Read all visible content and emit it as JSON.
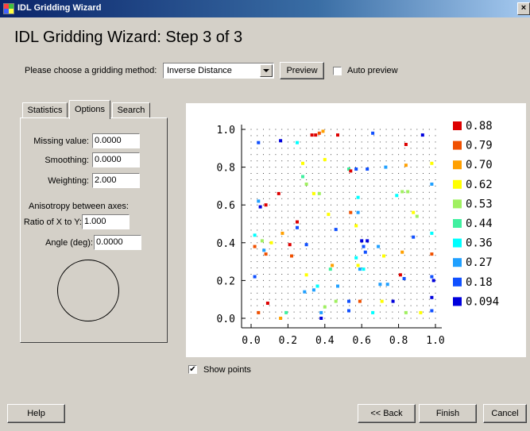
{
  "window": {
    "title": "IDL Gridding Wizard",
    "close_symbol": "×"
  },
  "wizard": {
    "step_title": "IDL Gridding Wizard: Step 3 of 3"
  },
  "method": {
    "prompt": "Please choose a gridding method:",
    "selected": "Inverse Distance",
    "preview_label": "Preview",
    "auto_preview_label": "Auto preview",
    "auto_preview_checked": false
  },
  "tabs": [
    {
      "label": "Statistics",
      "active": false
    },
    {
      "label": "Options",
      "active": true
    },
    {
      "label": "Search",
      "active": false
    }
  ],
  "options": {
    "missing_value_label": "Missing value:",
    "missing_value": "0.0000",
    "smoothing_label": "Smoothing:",
    "smoothing": "0.0000",
    "weighting_label": "Weighting:",
    "weighting": "2.000",
    "anisotropy_label": "Anisotropy between axes:",
    "ratio_label": "Ratio of X to Y:",
    "ratio": "1.000",
    "angle_label": "Angle (deg):",
    "angle": "0.0000"
  },
  "show_points": {
    "label": "Show points",
    "checked": true
  },
  "footer": {
    "help_label": "Help",
    "back_label": "<< Back",
    "finish_label": "Finish",
    "cancel_label": "Cancel"
  },
  "chart_data": {
    "type": "scatter",
    "xlim": [
      0,
      1
    ],
    "ylim": [
      0,
      1
    ],
    "x_ticks": [
      "0.0",
      "0.2",
      "0.4",
      "0.6",
      "0.8",
      "1.0"
    ],
    "y_ticks": [
      "0.0",
      "0.2",
      "0.4",
      "0.6",
      "0.8",
      "1.0"
    ],
    "grid_dots": true,
    "legend": [
      {
        "label": "0.88",
        "color": "#dd0000"
      },
      {
        "label": "0.79",
        "color": "#f05000"
      },
      {
        "label": "0.70",
        "color": "#ffa000"
      },
      {
        "label": "0.62",
        "color": "#ffff00"
      },
      {
        "label": "0.53",
        "color": "#a0f060"
      },
      {
        "label": "0.44",
        "color": "#40f0a0"
      },
      {
        "label": "0.36",
        "color": "#00ffff"
      },
      {
        "label": "0.27",
        "color": "#20a0ff"
      },
      {
        "label": "0.18",
        "color": "#1050ff"
      },
      {
        "label": "0.094",
        "color": "#0000dd"
      }
    ],
    "points": [
      {
        "x": 0.04,
        "y": 0.93,
        "c": 8
      },
      {
        "x": 0.16,
        "y": 0.94,
        "c": 9
      },
      {
        "x": 0.25,
        "y": 0.93,
        "c": 6
      },
      {
        "x": 0.33,
        "y": 0.97,
        "c": 0
      },
      {
        "x": 0.35,
        "y": 0.97,
        "c": 0
      },
      {
        "x": 0.37,
        "y": 0.98,
        "c": 1
      },
      {
        "x": 0.39,
        "y": 0.99,
        "c": 2
      },
      {
        "x": 0.47,
        "y": 0.97,
        "c": 0
      },
      {
        "x": 0.66,
        "y": 0.98,
        "c": 8
      },
      {
        "x": 0.84,
        "y": 0.92,
        "c": 0
      },
      {
        "x": 0.93,
        "y": 0.97,
        "c": 9
      },
      {
        "x": 0.98,
        "y": 0.82,
        "c": 3
      },
      {
        "x": 0.28,
        "y": 0.82,
        "c": 3
      },
      {
        "x": 0.4,
        "y": 0.84,
        "c": 3
      },
      {
        "x": 0.53,
        "y": 0.79,
        "c": 5
      },
      {
        "x": 0.54,
        "y": 0.78,
        "c": 0
      },
      {
        "x": 0.57,
        "y": 0.79,
        "c": 8
      },
      {
        "x": 0.63,
        "y": 0.79,
        "c": 8
      },
      {
        "x": 0.73,
        "y": 0.8,
        "c": 7
      },
      {
        "x": 0.84,
        "y": 0.81,
        "c": 2
      },
      {
        "x": 0.28,
        "y": 0.75,
        "c": 5
      },
      {
        "x": 0.3,
        "y": 0.71,
        "c": 4
      },
      {
        "x": 0.82,
        "y": 0.67,
        "c": 4
      },
      {
        "x": 0.85,
        "y": 0.67,
        "c": 4
      },
      {
        "x": 0.98,
        "y": 0.71,
        "c": 7
      },
      {
        "x": 0.04,
        "y": 0.62,
        "c": 7
      },
      {
        "x": 0.08,
        "y": 0.6,
        "c": 0
      },
      {
        "x": 0.05,
        "y": 0.59,
        "c": 9
      },
      {
        "x": 0.15,
        "y": 0.66,
        "c": 0
      },
      {
        "x": 0.34,
        "y": 0.66,
        "c": 3
      },
      {
        "x": 0.37,
        "y": 0.66,
        "c": 4
      },
      {
        "x": 0.58,
        "y": 0.64,
        "c": 6
      },
      {
        "x": 0.79,
        "y": 0.65,
        "c": 6
      },
      {
        "x": 0.88,
        "y": 0.56,
        "c": 3
      },
      {
        "x": 0.9,
        "y": 0.54,
        "c": 4
      },
      {
        "x": 0.25,
        "y": 0.51,
        "c": 0
      },
      {
        "x": 0.42,
        "y": 0.55,
        "c": 3
      },
      {
        "x": 0.54,
        "y": 0.56,
        "c": 1
      },
      {
        "x": 0.58,
        "y": 0.56,
        "c": 7
      },
      {
        "x": 0.25,
        "y": 0.48,
        "c": 8
      },
      {
        "x": 0.57,
        "y": 0.49,
        "c": 3
      },
      {
        "x": 0.46,
        "y": 0.47,
        "c": 8
      },
      {
        "x": 0.17,
        "y": 0.45,
        "c": 2
      },
      {
        "x": 0.02,
        "y": 0.44,
        "c": 6
      },
      {
        "x": 0.06,
        "y": 0.41,
        "c": 4
      },
      {
        "x": 0.11,
        "y": 0.4,
        "c": 3
      },
      {
        "x": 0.02,
        "y": 0.38,
        "c": 1
      },
      {
        "x": 0.07,
        "y": 0.36,
        "c": 7
      },
      {
        "x": 0.08,
        "y": 0.34,
        "c": 1
      },
      {
        "x": 0.21,
        "y": 0.39,
        "c": 0
      },
      {
        "x": 0.3,
        "y": 0.39,
        "c": 8
      },
      {
        "x": 0.6,
        "y": 0.41,
        "c": 9
      },
      {
        "x": 0.63,
        "y": 0.41,
        "c": 9
      },
      {
        "x": 0.61,
        "y": 0.38,
        "c": 8
      },
      {
        "x": 0.69,
        "y": 0.38,
        "c": 7
      },
      {
        "x": 0.62,
        "y": 0.35,
        "c": 8
      },
      {
        "x": 0.82,
        "y": 0.35,
        "c": 2
      },
      {
        "x": 0.88,
        "y": 0.43,
        "c": 8
      },
      {
        "x": 0.98,
        "y": 0.45,
        "c": 6
      },
      {
        "x": 0.22,
        "y": 0.33,
        "c": 1
      },
      {
        "x": 0.57,
        "y": 0.32,
        "c": 6
      },
      {
        "x": 0.72,
        "y": 0.33,
        "c": 3
      },
      {
        "x": 0.98,
        "y": 0.34,
        "c": 1
      },
      {
        "x": 0.44,
        "y": 0.28,
        "c": 2
      },
      {
        "x": 0.43,
        "y": 0.26,
        "c": 5
      },
      {
        "x": 0.58,
        "y": 0.28,
        "c": 3
      },
      {
        "x": 0.59,
        "y": 0.26,
        "c": 7
      },
      {
        "x": 0.61,
        "y": 0.26,
        "c": 6
      },
      {
        "x": 0.3,
        "y": 0.23,
        "c": 3
      },
      {
        "x": 0.81,
        "y": 0.23,
        "c": 0
      },
      {
        "x": 0.83,
        "y": 0.21,
        "c": 8
      },
      {
        "x": 0.02,
        "y": 0.22,
        "c": 8
      },
      {
        "x": 0.98,
        "y": 0.22,
        "c": 8
      },
      {
        "x": 0.99,
        "y": 0.2,
        "c": 9
      },
      {
        "x": 0.7,
        "y": 0.18,
        "c": 7
      },
      {
        "x": 0.74,
        "y": 0.18,
        "c": 7
      },
      {
        "x": 0.36,
        "y": 0.17,
        "c": 6
      },
      {
        "x": 0.47,
        "y": 0.17,
        "c": 7
      },
      {
        "x": 0.34,
        "y": 0.15,
        "c": 7
      },
      {
        "x": 0.29,
        "y": 0.14,
        "c": 7
      },
      {
        "x": 0.98,
        "y": 0.11,
        "c": 9
      },
      {
        "x": 0.09,
        "y": 0.08,
        "c": 0
      },
      {
        "x": 0.46,
        "y": 0.09,
        "c": 4
      },
      {
        "x": 0.53,
        "y": 0.09,
        "c": 8
      },
      {
        "x": 0.59,
        "y": 0.09,
        "c": 1
      },
      {
        "x": 0.71,
        "y": 0.09,
        "c": 3
      },
      {
        "x": 0.77,
        "y": 0.09,
        "c": 9
      },
      {
        "x": 0.4,
        "y": 0.06,
        "c": 4
      },
      {
        "x": 0.04,
        "y": 0.03,
        "c": 1
      },
      {
        "x": 0.19,
        "y": 0.03,
        "c": 5
      },
      {
        "x": 0.38,
        "y": 0.03,
        "c": 7
      },
      {
        "x": 0.53,
        "y": 0.04,
        "c": 8
      },
      {
        "x": 0.66,
        "y": 0.03,
        "c": 6
      },
      {
        "x": 0.84,
        "y": 0.03,
        "c": 4
      },
      {
        "x": 0.92,
        "y": 0.03,
        "c": 3
      },
      {
        "x": 0.98,
        "y": 0.04,
        "c": 8
      },
      {
        "x": 0.16,
        "y": 0.0,
        "c": 2
      },
      {
        "x": 0.38,
        "y": 0.0,
        "c": 9
      }
    ]
  }
}
